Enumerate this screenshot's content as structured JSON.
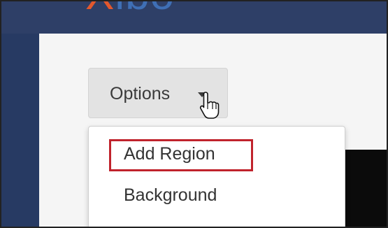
{
  "app": {
    "logo_first": "X",
    "logo_rest": "ibo"
  },
  "toolbar": {
    "options_label": "Options"
  },
  "menu": {
    "items": [
      {
        "label": "Add Region"
      },
      {
        "label": "Background"
      }
    ]
  },
  "annotation": {
    "highlight_color": "#c0232c"
  },
  "colors": {
    "topbar": "#2e3f67",
    "sidebar": "#273a63",
    "logo_accent": "#e2582d",
    "logo_main": "#3f6fb5",
    "content_bg": "#f5f5f5"
  }
}
